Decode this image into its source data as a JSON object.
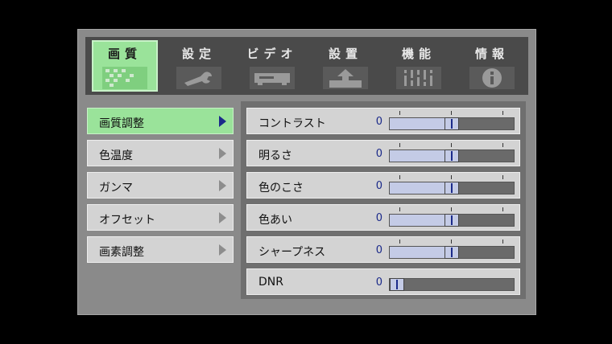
{
  "tabs": [
    {
      "label": "画質",
      "icon": "picture-quality-icon",
      "active": true
    },
    {
      "label": "設定",
      "icon": "wrench-icon",
      "active": false
    },
    {
      "label": "ビデオ",
      "icon": "video-player-icon",
      "active": false
    },
    {
      "label": "設置",
      "icon": "install-arrow-icon",
      "active": false
    },
    {
      "label": "機能",
      "icon": "functions-icon",
      "active": false
    },
    {
      "label": "情報",
      "icon": "info-icon",
      "active": false
    }
  ],
  "sidebar": {
    "items": [
      {
        "label": "画質調整",
        "active": true
      },
      {
        "label": "色温度",
        "active": false
      },
      {
        "label": "ガンマ",
        "active": false
      },
      {
        "label": "オフセット",
        "active": false
      },
      {
        "label": "画素調整",
        "active": false
      }
    ]
  },
  "settings": [
    {
      "label": "コントラスト",
      "value": "0",
      "level": 0.5
    },
    {
      "label": "明るさ",
      "value": "0",
      "level": 0.5
    },
    {
      "label": "色のこさ",
      "value": "0",
      "level": 0.5
    },
    {
      "label": "色あい",
      "value": "0",
      "level": 0.5
    },
    {
      "label": "シャープネス",
      "value": "0",
      "level": 0.5
    },
    {
      "label": "DNR",
      "value": "0",
      "level": 0.0
    }
  ],
  "colors": {
    "active_highlight": "#9ae39a",
    "value_text": "#1b2a8a",
    "slider_fill": "#c4cbe6"
  }
}
